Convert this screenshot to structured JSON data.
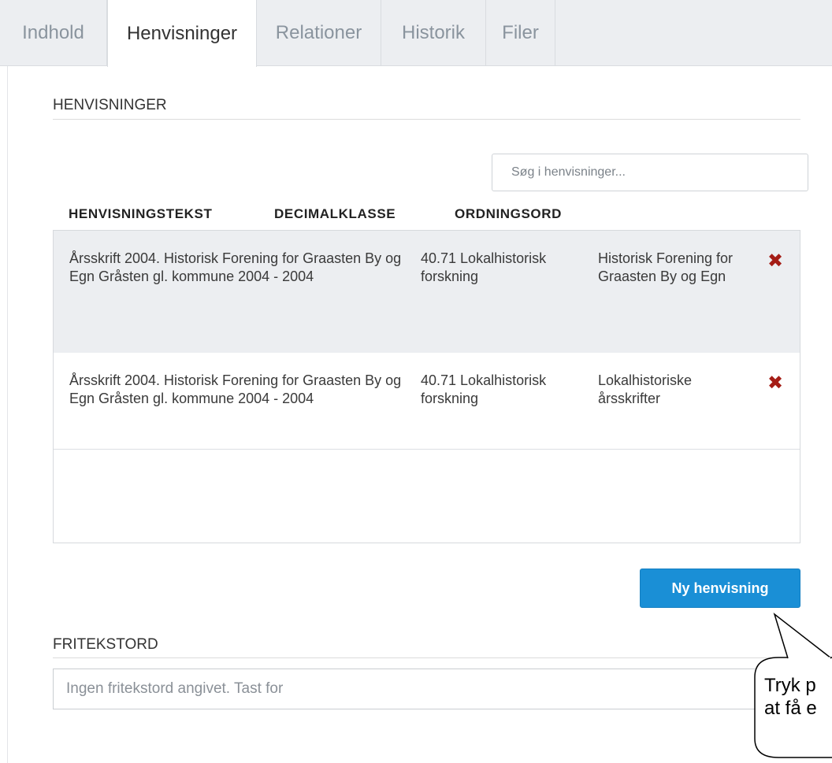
{
  "tabs": [
    {
      "label": "Indhold",
      "active": false
    },
    {
      "label": "Henvisninger",
      "active": true
    },
    {
      "label": "Relationer",
      "active": false
    },
    {
      "label": "Historik",
      "active": false
    },
    {
      "label": "Filer",
      "active": false
    }
  ],
  "references": {
    "title": "HENVISNINGER",
    "search_placeholder": "Søg i henvisninger...",
    "columns": [
      "HENVISNINGSTEKST",
      "DECIMALKLASSE",
      "ORDNINGSORD"
    ],
    "rows": [
      {
        "text": "Årsskrift 2004. Historisk Forening for Graasten By og Egn Gråsten gl. kommune 2004 - 2004",
        "decimal_class": "40.71 Lokalhistorisk forskning",
        "order_word": "Historisk Forening for Graasten By og Egn",
        "selected": true,
        "delete_icon": "close-x-icon"
      },
      {
        "text": "Årsskrift 2004. Historisk Forening for Graasten By og Egn Gråsten gl. kommune 2004 - 2004",
        "decimal_class": "40.71 Lokalhistorisk forskning",
        "order_word": "Lokalhistoriske årsskrifter",
        "selected": false,
        "delete_icon": "close-x-icon"
      }
    ],
    "new_button_label": "Ny henvisning"
  },
  "free_text": {
    "title": "FRITEKSTORD",
    "placeholder": "Ingen fritekstord angivet. Tast for"
  },
  "callout": {
    "text": "Tryk p\nat få e"
  },
  "colors": {
    "accent": "#1a8fd6",
    "delete": "#a51d16",
    "selected_row": "#eceef1"
  }
}
